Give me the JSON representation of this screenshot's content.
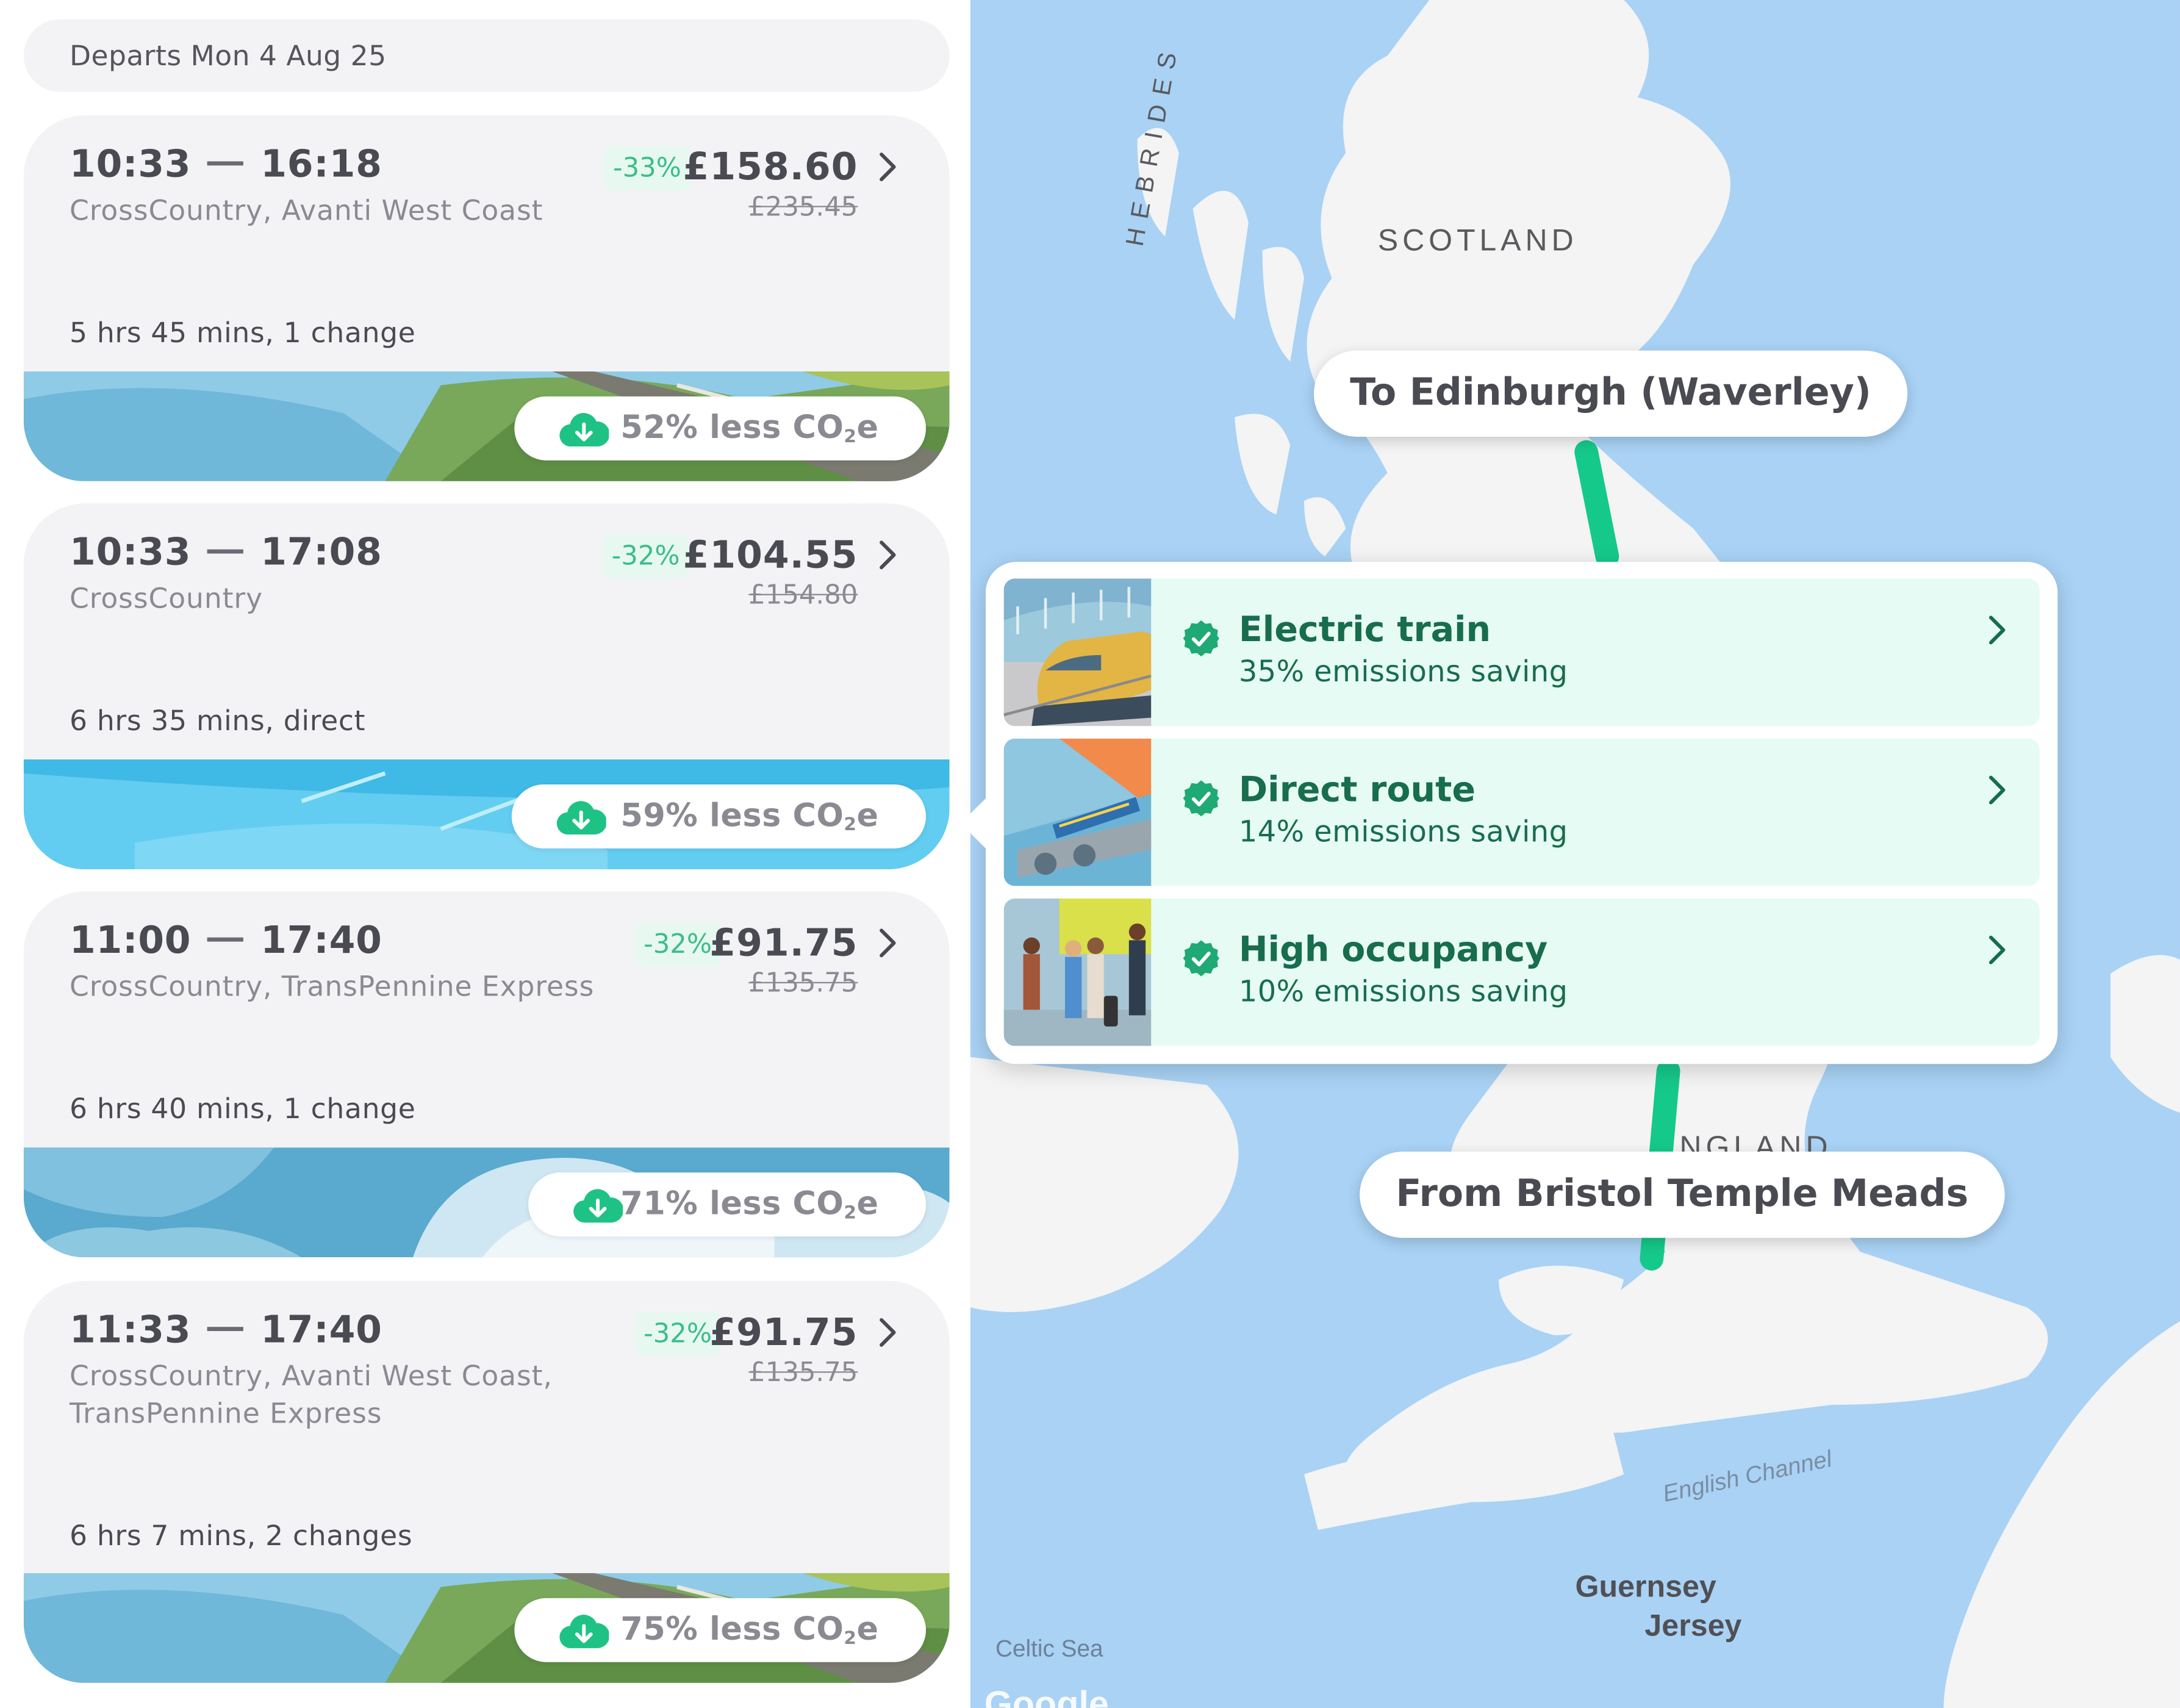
{
  "departs": "Departs Mon 4 Aug 25",
  "journeys": [
    {
      "depart": "10:33",
      "arrive": "16:18",
      "operators": "CrossCountry, Avanti West Coast",
      "discount": "-33%",
      "price": "£158.60",
      "old_price": "£235.45",
      "duration": "5 hrs 45 mins, 1 change",
      "co2": "52% less CO",
      "co2_sub": "2",
      "co2_tail": "e"
    },
    {
      "depart": "10:33",
      "arrive": "17:08",
      "operators": "CrossCountry",
      "discount": "-32%",
      "price": "£104.55",
      "old_price": "£154.80",
      "duration": "6 hrs 35 mins, direct",
      "co2": "59% less CO",
      "co2_sub": "2",
      "co2_tail": "e"
    },
    {
      "depart": "11:00",
      "arrive": "17:40",
      "operators": "CrossCountry, TransPennine Express",
      "discount": "-32%",
      "price": "£91.75",
      "old_price": "£135.75",
      "duration": "6 hrs 40 mins, 1 change",
      "co2": "71% less CO",
      "co2_sub": "2",
      "co2_tail": "e"
    },
    {
      "depart": "11:33",
      "arrive": "17:40",
      "operators": "CrossCountry, Avanti West Coast, TransPennine Express",
      "discount": "-32%",
      "price": "£91.75",
      "old_price": "£135.75",
      "duration": "6 hrs 7 mins, 2 changes",
      "co2": "75% less CO",
      "co2_sub": "2",
      "co2_tail": "e"
    }
  ],
  "map": {
    "to_label": "To Edinburgh (Waverley)",
    "from_label": "From Bristol Temple Meads",
    "scotland": "SCOTLAND",
    "hebrides": "HEBRIDES",
    "england": "NGLAND",
    "english_channel": "English Channel",
    "guernsey": "Guernsey",
    "jersey": "Jersey",
    "celtic_sea": "Celtic Sea",
    "google": "Google",
    "route_color": "#15c98b"
  },
  "savings": [
    {
      "title": "Electric train",
      "subtitle": "35% emissions saving"
    },
    {
      "title": "Direct route",
      "subtitle": "14% emissions saving"
    },
    {
      "title": "High occupancy",
      "subtitle": "10% emissions saving"
    }
  ],
  "colors": {
    "accent": "#3bbd8c",
    "dark_green": "#176d4e",
    "card_bg": "#f3f3f6",
    "map_water": "#a9d2f5"
  }
}
